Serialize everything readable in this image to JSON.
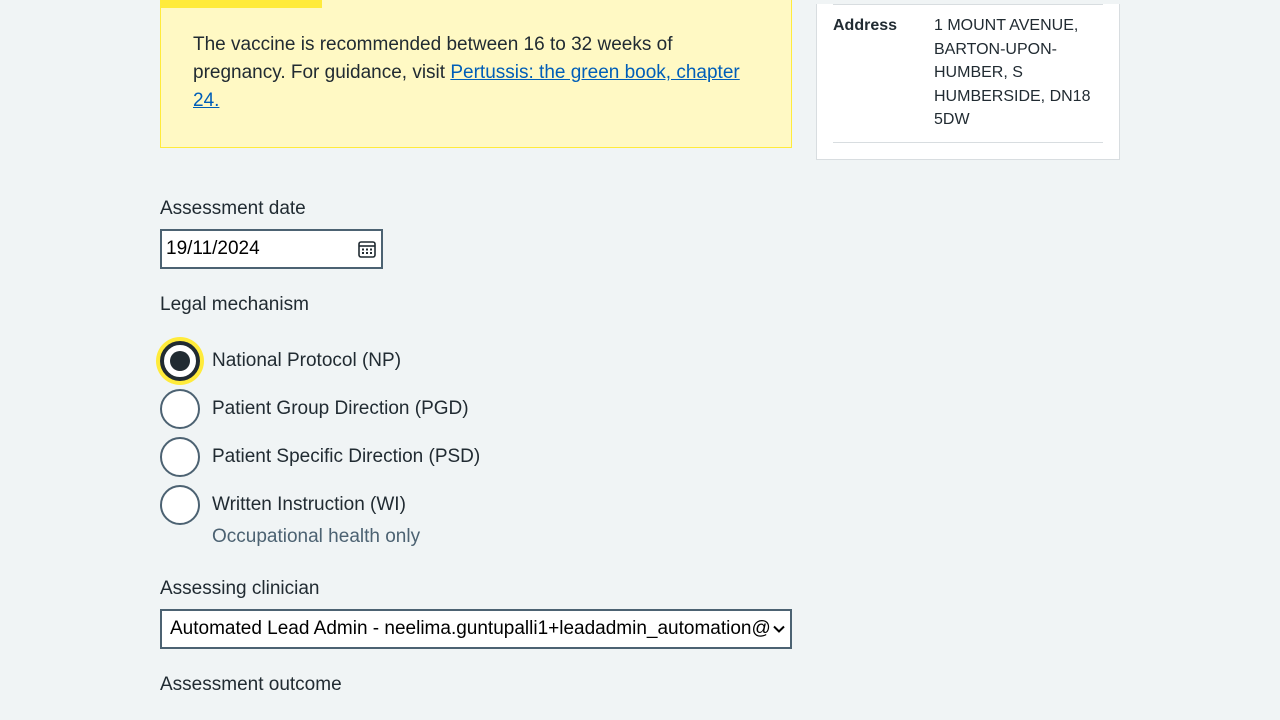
{
  "inset": {
    "text": "The vaccine is recommended between 16 to 32 weeks of pregnancy. For guidance, visit ",
    "link_text": "Pertussis: the green book, chapter 24."
  },
  "patient_card": {
    "address_key": "Address",
    "address_value": "1 MOUNT AVENUE, BARTON-UPON-HUMBER, S HUMBERSIDE, DN18 5DW"
  },
  "form": {
    "assessment_date_label": "Assessment date",
    "assessment_date_value": "19/11/2024",
    "legal_mechanism_label": "Legal mechanism",
    "legal_mechanism_options": [
      {
        "label": "National Protocol (NP)",
        "checked": true
      },
      {
        "label": "Patient Group Direction (PGD)",
        "checked": false
      },
      {
        "label": "Patient Specific Direction (PSD)",
        "checked": false
      },
      {
        "label": "Written Instruction (WI)",
        "checked": false,
        "hint": "Occupational health only"
      }
    ],
    "assessing_clinician_label": "Assessing clinician",
    "assessing_clinician_value": "Automated Lead Admin - neelima.guntupalli1+leadadmin_automation@nhs.net",
    "assessment_outcome_label": "Assessment outcome"
  },
  "icons": {
    "calendar": "calendar-icon",
    "select_chevron": "chevron-down-icon"
  },
  "colors": {
    "background": "#f0f4f5",
    "inset_bg": "#fff9c4",
    "inset_accent": "#ffeb3b",
    "link": "#005eb8",
    "text": "#212b32",
    "hint": "#4c6272"
  }
}
